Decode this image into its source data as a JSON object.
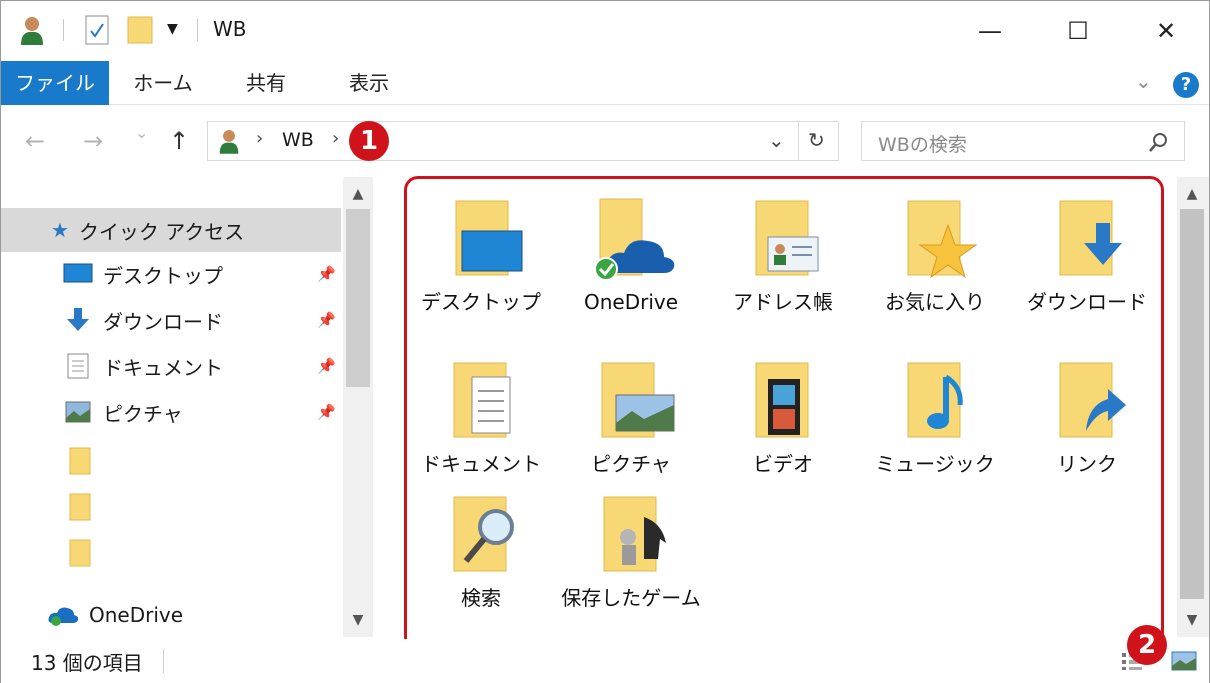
{
  "window": {
    "title": "WB",
    "minimize": "—",
    "maximize": "☐",
    "close": "✕"
  },
  "ribbon": {
    "tabs": [
      "ファイル",
      "ホーム",
      "共有",
      "表示"
    ],
    "help": "?"
  },
  "nav": {
    "back": "←",
    "forward": "→",
    "recent": "⌄",
    "up": "↑",
    "address": {
      "sep1": "›",
      "crumb": "WB",
      "sep2": "›",
      "dropdown": "⌄",
      "refresh": "↻"
    },
    "search_placeholder": "WBの検索"
  },
  "sidebar": {
    "quick_access": "クイック アクセス",
    "items": [
      {
        "label": "デスクトップ"
      },
      {
        "label": "ダウンロード"
      },
      {
        "label": "ドキュメント"
      },
      {
        "label": "ピクチャ"
      }
    ],
    "onedrive": "OneDrive"
  },
  "content": {
    "items": [
      {
        "label": "デスクトップ"
      },
      {
        "label": "OneDrive"
      },
      {
        "label": "アドレス帳"
      },
      {
        "label": "お気に入り"
      },
      {
        "label": "ダウンロード"
      },
      {
        "label": "ドキュメント"
      },
      {
        "label": "ピクチャ"
      },
      {
        "label": "ビデオ"
      },
      {
        "label": "ミュージック"
      },
      {
        "label": "リンク"
      },
      {
        "label": "検索"
      },
      {
        "label": "保存したゲーム"
      }
    ]
  },
  "status": {
    "count": "13 個の項目"
  },
  "annotations": {
    "badge1": "1",
    "badge2": "2"
  },
  "colors": {
    "accent": "#1979ca",
    "annotation_red": "#d0121b",
    "folder": "#f8d775"
  }
}
